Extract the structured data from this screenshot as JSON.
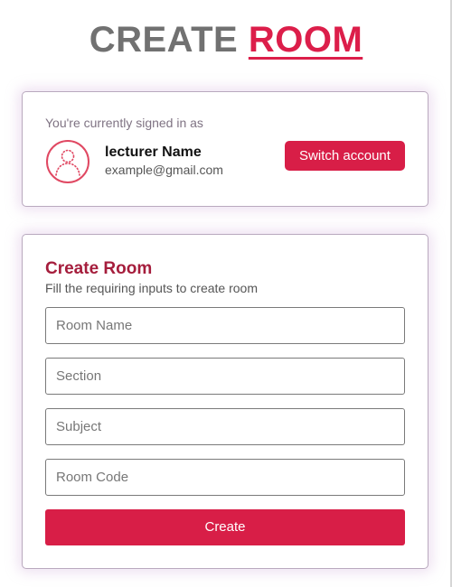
{
  "header": {
    "title_word_1": "CREATE",
    "title_word_2": "ROOM"
  },
  "account": {
    "signed_in_text": "You're currently signed in as",
    "avatar_icon": "user-avatar-icon",
    "name": "lecturer Name",
    "email": "example@gmail.com",
    "switch_label": "Switch account"
  },
  "form": {
    "title": "Create Room",
    "subtitle": "Fill the requiring inputs to create room",
    "fields": [
      {
        "placeholder": "Room Name",
        "value": ""
      },
      {
        "placeholder": "Section",
        "value": ""
      },
      {
        "placeholder": "Subject",
        "value": ""
      },
      {
        "placeholder": "Room Code",
        "value": ""
      }
    ],
    "submit_label": "Create"
  },
  "colors": {
    "accent": "#d81e47",
    "title_gray": "#717171",
    "form_title": "#a51d3c"
  }
}
